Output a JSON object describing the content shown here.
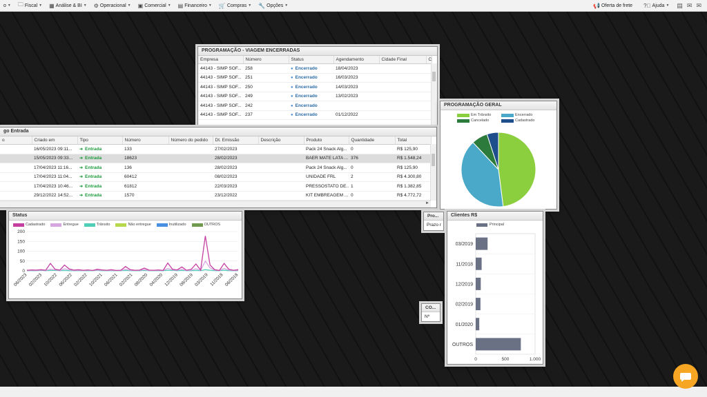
{
  "menu": {
    "items": [
      {
        "label": "o",
        "icon": "home-icon"
      },
      {
        "label": "Fiscal",
        "icon": "folder-icon"
      },
      {
        "label": "Análise & BI",
        "icon": "grid-icon"
      },
      {
        "label": "Operacional",
        "icon": "gear-icon"
      },
      {
        "label": "Comercial",
        "icon": "building-icon"
      },
      {
        "label": "Financeiro",
        "icon": "chart-icon"
      },
      {
        "label": "Compras",
        "icon": "cart-icon"
      },
      {
        "label": "Opções",
        "icon": "wrench-icon"
      }
    ],
    "oferta": "Oferta de frete",
    "ajuda": "Ajuda"
  },
  "viagem": {
    "title": "PROGRAMAÇÃO - VIAGEM ENCERRADAS",
    "columns": [
      "Empresa",
      "Número",
      "Status",
      "Agendamento",
      "Cidade Final",
      "Cid"
    ],
    "rows": [
      [
        "44143 - SIMP SOF...",
        "258",
        "Encerrado",
        "18/04/2023"
      ],
      [
        "44143 - SIMP SOF...",
        "251",
        "Encerrado",
        "16/03/2023"
      ],
      [
        "44143 - SIMP SOF...",
        "250",
        "Encerrado",
        "14/03/2023"
      ],
      [
        "44143 - SIMP SOF...",
        "249",
        "Encerrado",
        "13/02/2023"
      ],
      [
        "44143 - SIMP SOF...",
        "242",
        "Encerrado",
        ""
      ],
      [
        "44143 - SIMP SOF...",
        "237",
        "Encerrado",
        "01/12/2022"
      ]
    ]
  },
  "entrada": {
    "title": "go Entrada",
    "columns": [
      "o",
      "Criado em",
      "Tipo",
      "Número",
      "Número do pedido",
      "Dt. Emissão",
      "Descrição",
      "Produto",
      "Quantidade",
      "Total"
    ],
    "rows": [
      [
        "16/05/2023 09:11...",
        "Entrada",
        "133",
        "",
        "27/02/2023",
        "",
        "Pack 24 Snack Alg...",
        "0",
        "R$ 125,90"
      ],
      [
        "15/05/2023 09:33...",
        "Entrada",
        "18623",
        "",
        "28/02/2023",
        "",
        "BAER MATE LATA ...",
        "376",
        "R$ 1.548,24"
      ],
      [
        "17/04/2023 11:16...",
        "Entrada",
        "136",
        "",
        "28/02/2023",
        "",
        "Pack 24 Snack Alg...",
        "0",
        "R$ 125,90"
      ],
      [
        "17/04/2023 11:04...",
        "Entrada",
        "60412",
        "",
        "08/02/2023",
        "",
        "UNIDADE FRL",
        "2",
        "R$ 4.300,80"
      ],
      [
        "17/04/2023 10:46...",
        "Entrada",
        "61812",
        "",
        "22/03/2023",
        "",
        "PRESSOSTATO DE...",
        "1",
        "R$ 1.382,85"
      ],
      [
        "29/12/2022 14:52...",
        "Entrada",
        "1570",
        "",
        "23/12/2022",
        "",
        "KIT EMBREAGEM ...",
        "0",
        "R$ 4.772,72"
      ]
    ]
  },
  "status": {
    "title": "Status",
    "chart_data": {
      "type": "line",
      "title": "",
      "legend": [
        {
          "name": "Cadastrado",
          "color": "#c43fa0"
        },
        {
          "name": "Entregue",
          "color": "#d7a6e0"
        },
        {
          "name": "Trânsito",
          "color": "#4fcfb8"
        },
        {
          "name": "Não entregue",
          "color": "#b6d84a"
        },
        {
          "name": "Inutilizado",
          "color": "#4a90e2"
        },
        {
          "name": "OUTROS",
          "color": "#6f9a4f"
        }
      ],
      "y_ticks": [
        "200",
        "150",
        "100",
        "50",
        "0"
      ],
      "ylim": [
        0,
        200
      ],
      "x_ticks": [
        "06/2023",
        "02/2023",
        "10/2022",
        "06/2022",
        "02/2022",
        "10/2021",
        "06/2021",
        "02/2021",
        "08/2020",
        "04/2020",
        "12/2019",
        "08/2019",
        "03/2019",
        "11/2018",
        "06/2018"
      ],
      "series": [
        {
          "name": "Cadastrado",
          "values": [
            3,
            5,
            4,
            6,
            3,
            38,
            8,
            4,
            30,
            10,
            4,
            6,
            3,
            5,
            2,
            8,
            5,
            3,
            6,
            2,
            3,
            22,
            6,
            3,
            4,
            14,
            4,
            3,
            5,
            2,
            40,
            8,
            5,
            20,
            3,
            8,
            35,
            4,
            178,
            30,
            6,
            2,
            38,
            8,
            3,
            6
          ]
        },
        {
          "name": "Entregue",
          "values": [
            2,
            3,
            2,
            4,
            2,
            8,
            6,
            2,
            10,
            5,
            2,
            3,
            2,
            3,
            2,
            4,
            3,
            2,
            3,
            2,
            2,
            8,
            3,
            2,
            3,
            6,
            2,
            2,
            3,
            2,
            12,
            5,
            3,
            8,
            2,
            4,
            10,
            3,
            50,
            15,
            4,
            2,
            12,
            4,
            2,
            3
          ]
        },
        {
          "name": "Trânsito",
          "values": [
            1,
            1,
            1,
            2,
            1,
            2,
            2,
            1,
            2,
            1,
            1,
            1,
            1,
            1,
            1,
            2,
            1,
            1,
            1,
            1,
            1,
            2,
            1,
            1,
            1,
            2,
            1,
            1,
            1,
            1,
            3,
            2,
            1,
            2,
            1,
            1,
            2,
            1,
            6,
            3,
            1,
            1,
            3,
            1,
            1,
            1
          ]
        }
      ]
    }
  },
  "programacao_geral": {
    "title": "PROGRAMAÇÃO GERAL",
    "chart_data": {
      "type": "pie",
      "title": "",
      "slices": [
        {
          "name": "Em Trânsito",
          "value": 48,
          "color": "#8ccf3e"
        },
        {
          "name": "Encerrado",
          "value": 40,
          "color": "#4aa9c8"
        },
        {
          "name": "Cancelado",
          "value": 7,
          "color": "#2c7a3c"
        },
        {
          "name": "Cadastrado",
          "value": 5,
          "color": "#1f4e8c"
        }
      ]
    }
  },
  "clientes": {
    "title": "Clientes R$",
    "chart_data": {
      "type": "bar",
      "title": "",
      "series_name": "Principal",
      "color": "#6b7185",
      "categories": [
        "03/2019",
        "11/2018",
        "12/2019",
        "02/2019",
        "01/2020",
        "OUTROS"
      ],
      "values": [
        200,
        100,
        85,
        80,
        60,
        760
      ],
      "xlim": [
        0,
        1000
      ],
      "x_ticks": [
        "0",
        "500",
        "1.000"
      ]
    }
  },
  "mini_pro": {
    "title": "Pro...",
    "row": "Prazo r"
  },
  "mini_co": {
    "title": "CO...",
    "row": "Nº"
  }
}
